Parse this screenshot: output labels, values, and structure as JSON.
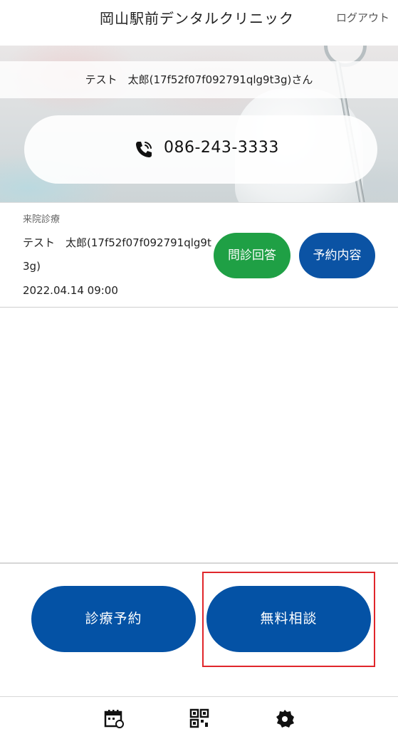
{
  "header": {
    "title": "岡山駅前デンタルクリニック",
    "logout_label": "ログアウト"
  },
  "hero": {
    "user_name": "テスト　太郎(17f52f07f092791qlg9t3g)さん",
    "phone_icon": "phone-icon",
    "phone_number": "086-243-3333"
  },
  "appointment": {
    "type_label": "来院診療",
    "patient_name": "テスト　太郎(17f52f07f092791qlg9t3g)",
    "datetime": "2022.04.14 09:00",
    "questionnaire_button": "問診回答",
    "details_button": "予約内容"
  },
  "actions": {
    "reserve_button": "診療予約",
    "consult_button": "無料相談"
  },
  "bottom_nav": {
    "items": [
      {
        "icon": "calendar-icon"
      },
      {
        "icon": "qr-code-icon"
      },
      {
        "icon": "gear-icon"
      }
    ]
  },
  "colors": {
    "primary_blue": "#0452a5",
    "green": "#1fa045",
    "highlight_red": "#e0262b"
  }
}
